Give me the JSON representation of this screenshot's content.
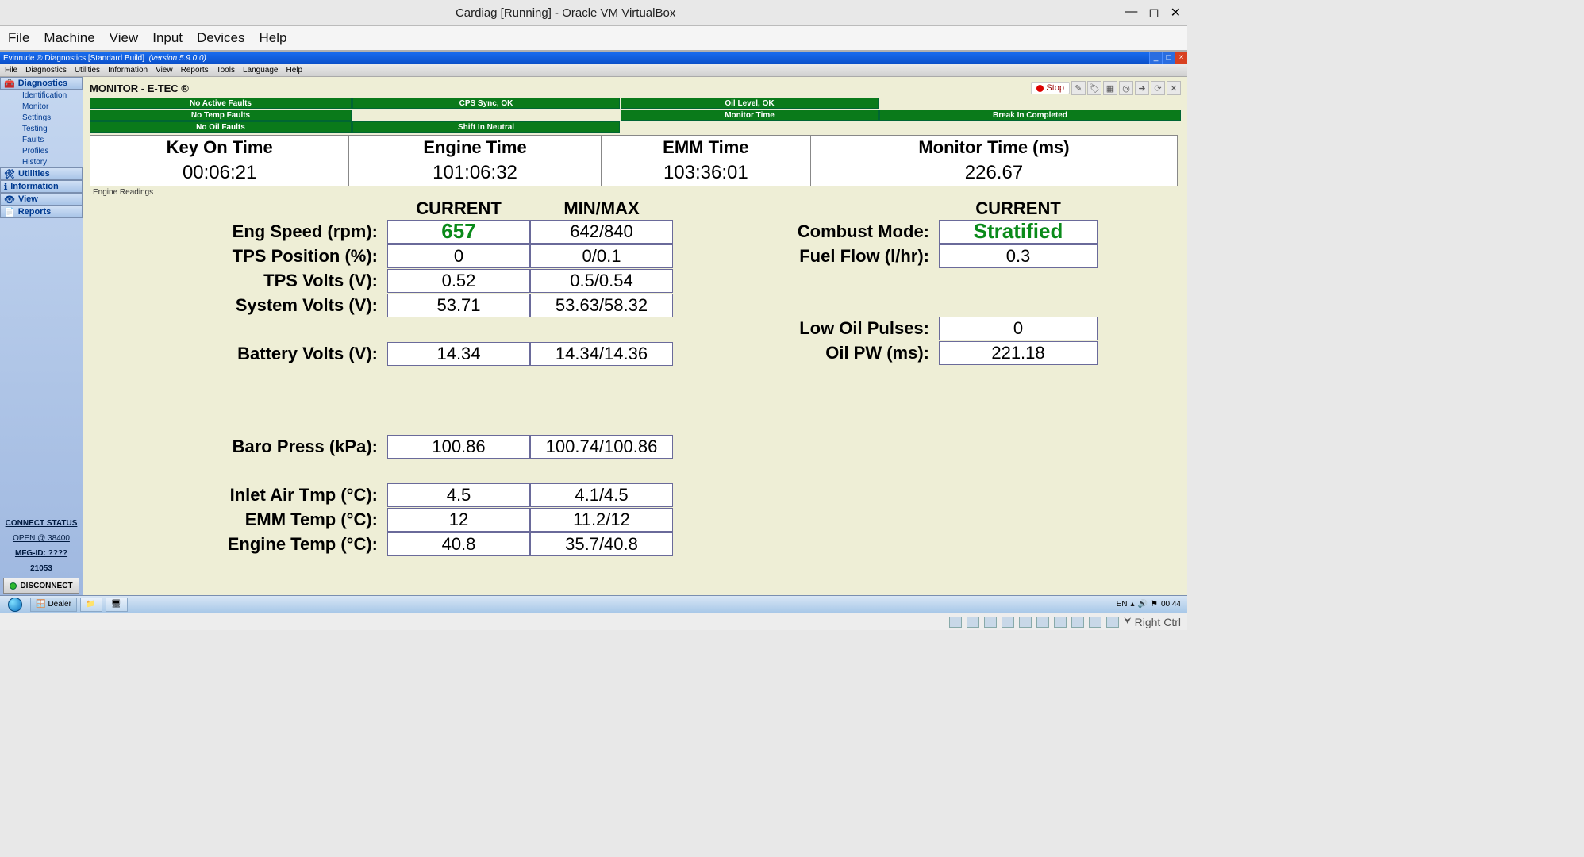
{
  "vbox": {
    "title": "Cardiag [Running] - Oracle VM VirtualBox",
    "menu": [
      "File",
      "Machine",
      "View",
      "Input",
      "Devices",
      "Help"
    ],
    "right_ctrl": "Right Ctrl"
  },
  "guest": {
    "title_prefix": "Evinrude ® Diagnostics  [Standard Build]",
    "title_version": "(version 5.9.0.0)",
    "menu": [
      "File",
      "Diagnostics",
      "Utilities",
      "Information",
      "View",
      "Reports",
      "Tools",
      "Language",
      "Help"
    ],
    "taskbar_app": "Dealer",
    "tray": {
      "lang": "EN",
      "clock": "00:44"
    }
  },
  "sidebar": {
    "diagnostics_header": "Diagnostics",
    "diag_items": [
      "Identification",
      "Monitor",
      "Settings",
      "Testing",
      "Faults",
      "Profiles",
      "History"
    ],
    "utilities_header": "Utilities",
    "information_header": "Information",
    "view_header": "View",
    "reports_header": "Reports",
    "status": {
      "title": "CONNECT STATUS",
      "open": "OPEN @ 38400",
      "mfg": "MFG-ID: ????",
      "id": "21053",
      "button": "DISCONNECT"
    }
  },
  "content": {
    "page_title": "MONITOR - E-TEC ®",
    "stop_label": "Stop",
    "status_grid": [
      [
        "No Active Faults",
        "CPS Sync, OK",
        "Oil Level, OK",
        ""
      ],
      [
        "No Temp Faults",
        "",
        "Monitor Time",
        "Break In Completed"
      ],
      [
        "No Oil Faults",
        "Shift In Neutral",
        "",
        ""
      ]
    ],
    "time_table": {
      "headers": [
        "Key On Time",
        "Engine Time",
        "EMM Time",
        "Monitor Time (ms)"
      ],
      "values": [
        "00:06:21",
        "101:06:32",
        "103:36:01",
        "226.67"
      ]
    },
    "engine_readings_label": "Engine Readings",
    "left_headers": {
      "current": "CURRENT",
      "minmax": "MIN/MAX"
    },
    "right_header": "CURRENT",
    "left_rows": [
      {
        "label": "Eng Speed (rpm):",
        "current": "657",
        "minmax": "642/840",
        "green": true
      },
      {
        "label": "TPS Position (%):",
        "current": "0",
        "minmax": "0/0.1"
      },
      {
        "label": "TPS Volts (V):",
        "current": "0.52",
        "minmax": "0.5/0.54"
      },
      {
        "label": "System Volts (V):",
        "current": "53.71",
        "minmax": "53.63/58.32"
      },
      {
        "spacer": true
      },
      {
        "label": "Battery Volts (V):",
        "current": "14.34",
        "minmax": "14.34/14.36"
      },
      {
        "bigspacer": true
      },
      {
        "label": "Baro Press (kPa):",
        "current": "100.86",
        "minmax": "100.74/100.86"
      },
      {
        "spacer": true
      },
      {
        "label": "Inlet Air Tmp (°C):",
        "current": "4.5",
        "minmax": "4.1/4.5"
      },
      {
        "label": "EMM Temp (°C):",
        "current": "12",
        "minmax": "11.2/12"
      },
      {
        "label": "Engine Temp (°C):",
        "current": "40.8",
        "minmax": "35.7/40.8"
      }
    ],
    "right_rows": [
      {
        "label": "Combust Mode:",
        "current": "Stratified",
        "green": true
      },
      {
        "label": "Fuel Flow (l/hr):",
        "current": "0.3"
      },
      {
        "bigspacer": true
      },
      {
        "label": "Low Oil Pulses:",
        "current": "0"
      },
      {
        "label": "Oil PW (ms):",
        "current": "221.18"
      }
    ]
  }
}
